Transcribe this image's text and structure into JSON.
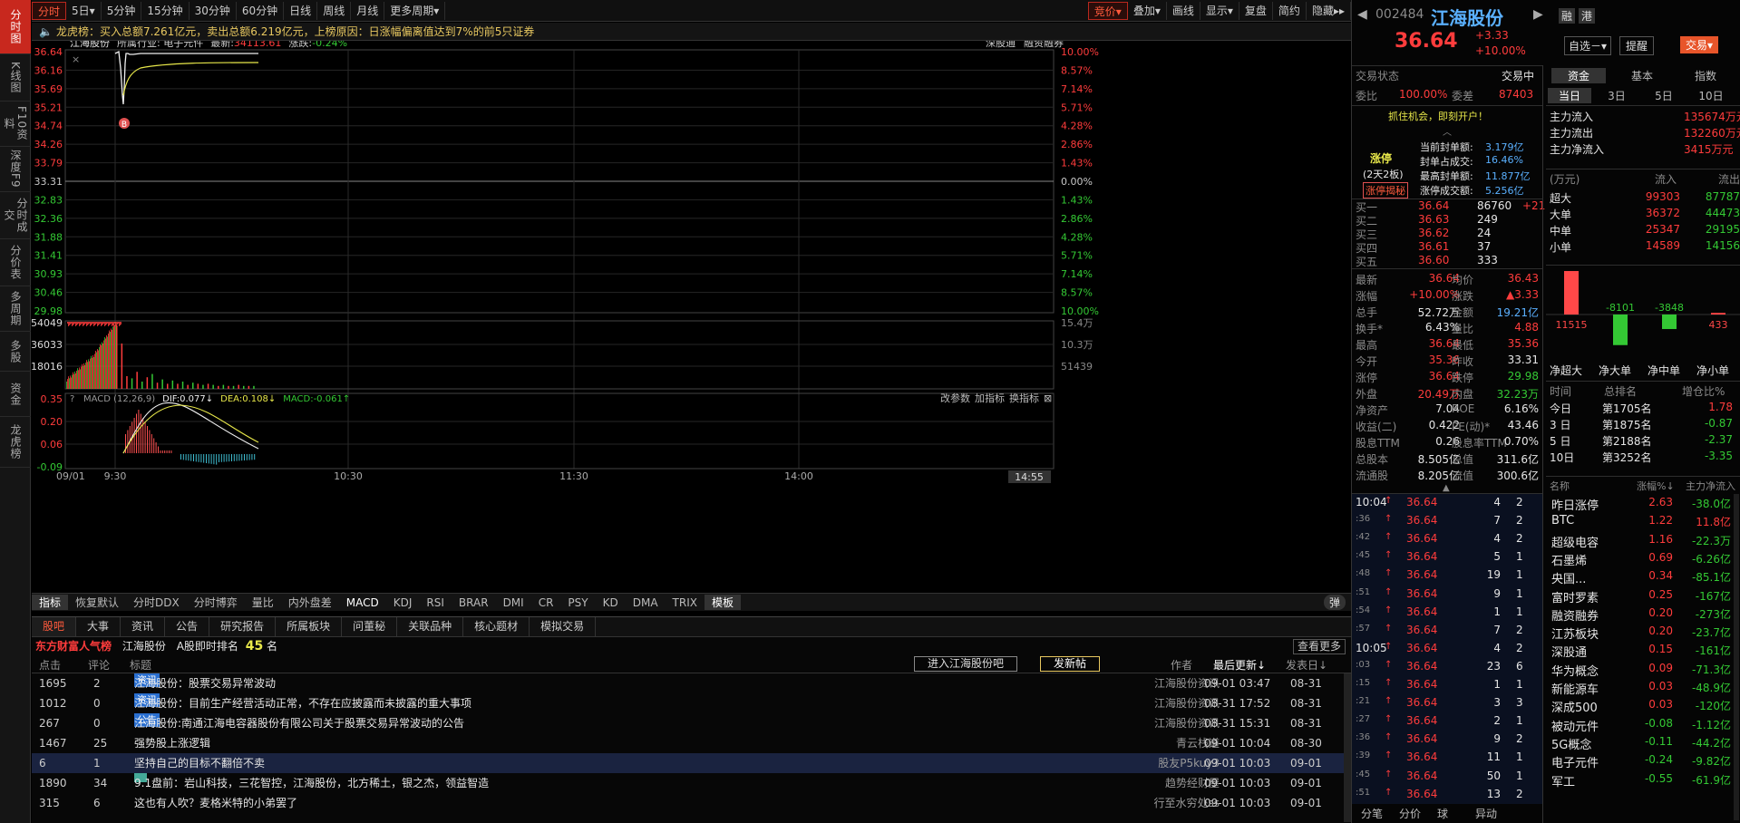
{
  "rail": [
    {
      "label": "分时图",
      "active": true
    },
    {
      "label": "K线图"
    },
    {
      "label": "F10资料"
    },
    {
      "label": "深度F9"
    },
    {
      "label": "分时成交"
    },
    {
      "label": "分价表"
    },
    {
      "label": "多周期"
    },
    {
      "label": "多股"
    },
    {
      "label": "资金"
    },
    {
      "label": "龙虎榜"
    }
  ],
  "toolbar": {
    "periods": [
      "分时",
      "5日▾",
      "5分钟",
      "15分钟",
      "30分钟",
      "60分钟",
      "日线",
      "周线",
      "月线",
      "更多周期▾"
    ],
    "right": [
      "竞价▾",
      "叠加▾",
      "画线",
      "显示▾",
      "复盘",
      "简约",
      "隐藏▸▸"
    ]
  },
  "notice": "龙虎榜：买入总额7.261亿元，卖出总额6.219亿元，上榜原因：日涨幅偏离值达到7%的前5只证券",
  "chart": {
    "stock_name": "江海股份",
    "industry": "所属行业: 电子元件",
    "latest_label": "最新:",
    "latest": "34113.61",
    "change_label": "涨跌:",
    "change": "-0.24%",
    "links": [
      "深股通",
      "融资融券"
    ],
    "price_ticks": [
      "36.64",
      "36.16",
      "35.69",
      "35.21",
      "34.74",
      "34.26",
      "33.79",
      "33.31",
      "32.83",
      "32.36",
      "31.88",
      "31.41",
      "30.93",
      "30.46",
      "29.98"
    ],
    "pct_ticks": [
      "10.00%",
      "8.57%",
      "7.14%",
      "5.71%",
      "4.28%",
      "2.86%",
      "1.43%",
      "0.00%",
      "1.43%",
      "2.86%",
      "4.28%",
      "5.71%",
      "7.14%",
      "8.57%",
      "10.00%"
    ],
    "vol_ticks": [
      "54049",
      "36033",
      "18016"
    ],
    "vol_right": [
      "15.4万",
      "10.3万",
      "51439"
    ],
    "macd_title": "MACD (12,26,9)",
    "dif": "DIF:0.077↓",
    "dea": "DEA:0.108↓",
    "macd": "MACD:-0.061↑",
    "macd_links": [
      "改参数",
      "加指标",
      "换指标"
    ],
    "macd_ticks": [
      "0.35",
      "0.20",
      "0.06",
      "-0.09"
    ],
    "time_ticks": [
      "09/01",
      "9:30",
      "10:30",
      "11:30",
      "14:00"
    ],
    "time_cursor": "14:55",
    "b_marker": "B"
  },
  "indicators": [
    "指标",
    "恢复默认",
    "分时DDX",
    "分时博弈",
    "量比",
    "内外盘差",
    "MACD",
    "KDJ",
    "RSI",
    "BRAR",
    "DMI",
    "CR",
    "PSY",
    "KD",
    "DMA",
    "TRIX",
    "模板"
  ],
  "indicator_toggle": "弹",
  "bottom": {
    "tabs": [
      "股吧",
      "大事",
      "资讯",
      "公告",
      "研究报告",
      "所属板块",
      "问董秘",
      "关联品种",
      "核心题材",
      "模拟交易"
    ],
    "rank_title": "东方财富人气榜",
    "rank_name": "江海股份",
    "rank_label": "A股即时排名",
    "rank": "45",
    "rank_unit": "名",
    "more": "查看更多",
    "cols": [
      "点击",
      "评论",
      "标题"
    ],
    "btn_enter": "进入江海股份吧",
    "btn_post": "发新帖",
    "cols_right": [
      "作者",
      "最后更新↓",
      "发表日↓"
    ],
    "rows": [
      {
        "clicks": "1695",
        "comments": "2",
        "tag": "资讯",
        "title": "江海股份：股票交易异常波动",
        "author": "江海股份资讯",
        "updated": "09-01 03:47",
        "date": "08-31"
      },
      {
        "clicks": "1012",
        "comments": "0",
        "tag": "资讯",
        "title": "江海股份：目前生产经营活动正常，不存在应披露而未披露的重大事项",
        "author": "江海股份资讯",
        "updated": "08-31 17:52",
        "date": "08-31"
      },
      {
        "clicks": "267",
        "comments": "0",
        "tag": "公告",
        "title": "江海股份:南通江海电容器股份有限公司关于股票交易异常波动的公告",
        "author": "江海股份资讯",
        "updated": "08-31 15:31",
        "date": "08-31"
      },
      {
        "clicks": "1467",
        "comments": "25",
        "tag": "",
        "title": "强势股上涨逻辑",
        "author": "青云栈道",
        "updated": "09-01 10:04",
        "date": "08-30"
      },
      {
        "clicks": "6",
        "comments": "1",
        "tag": "",
        "title": "坚持自己的目标不翻倍不卖",
        "author": "股友P5kuy3",
        "updated": "09-01 10:03",
        "date": "09-01",
        "selected": true
      },
      {
        "clicks": "1890",
        "comments": "34",
        "tag": "img",
        "title": "9.1盘前：岩山科技，三花智控，江海股份，北方稀土，银之杰，领益智造",
        "author": "趋势经财屋",
        "updated": "09-01 10:03",
        "date": "09-01"
      },
      {
        "clicks": "315",
        "comments": "6",
        "tag": "",
        "title": "这也有人吹？麦格米特的小弟罢了",
        "author": "行至水穷处ss",
        "updated": "09-01 10:03",
        "date": "09-01"
      }
    ]
  },
  "quote": {
    "code": "002484",
    "name": "江海股份",
    "price": "36.64",
    "change": "+3.33",
    "pct": "+10.00%",
    "btns": [
      "融",
      "港"
    ],
    "zixuan": "自选－▾",
    "remind": "提醒",
    "trade": "交易▾",
    "status_label": "交易状态",
    "status": "交易中",
    "weibi_label": "委比",
    "weibi": "100.00%",
    "weicha_label": "委差",
    "weicha": "87403",
    "ad": "抓住机会，即刻开户！",
    "limit_title": "涨停",
    "limit_sub": "(2天2板)",
    "limit_btn": "涨停揭秘",
    "limit_info": [
      [
        "当前封单额:",
        "3.179亿"
      ],
      [
        "封单占成交:",
        "16.46%"
      ],
      [
        "最高封单额:",
        "11.877亿"
      ],
      [
        "涨停成交额:",
        "5.256亿"
      ]
    ],
    "bids": [
      [
        "买一",
        "36.64",
        "86760",
        "+21"
      ],
      [
        "买二",
        "36.63",
        "249",
        ""
      ],
      [
        "买三",
        "36.62",
        "24",
        ""
      ],
      [
        "买四",
        "36.61",
        "37",
        ""
      ],
      [
        "买五",
        "36.60",
        "333",
        ""
      ]
    ],
    "stats": [
      [
        "最新",
        "36.64",
        "均价",
        "36.43"
      ],
      [
        "涨幅",
        "+10.00%",
        "涨跌",
        "▲3.33"
      ],
      [
        "总手",
        "52.72万",
        "金额",
        "19.21亿"
      ],
      [
        "换手*",
        "6.43%",
        "量比",
        "4.88"
      ],
      [
        "最高",
        "36.64",
        "最低",
        "35.36"
      ],
      [
        "今开",
        "35.36",
        "昨收",
        "33.31"
      ],
      [
        "涨停",
        "36.64",
        "跌停",
        "29.98"
      ],
      [
        "外盘",
        "20.49万",
        "内盘",
        "32.23万"
      ],
      [
        "净资产",
        "7.04",
        "ROE",
        "6.16%"
      ],
      [
        "收益(二)",
        "0.422",
        "PE(动)*",
        "43.46"
      ],
      [
        "股息TTM",
        "0.26",
        "股息率TTM",
        "0.70%"
      ],
      [
        "总股本",
        "8.505亿",
        "总值",
        "311.6亿"
      ],
      [
        "流通股",
        "8.205亿",
        "流值",
        "300.6亿"
      ]
    ],
    "ticks": [
      [
        "10:04",
        "36.64",
        "4",
        "2"
      ],
      [
        ":36",
        "36.64",
        "7",
        "2"
      ],
      [
        ":42",
        "36.64",
        "4",
        "2"
      ],
      [
        ":45",
        "36.64",
        "5",
        "1"
      ],
      [
        ":48",
        "36.64",
        "19",
        "1"
      ],
      [
        ":51",
        "36.64",
        "9",
        "1"
      ],
      [
        ":54",
        "36.64",
        "1",
        "1"
      ],
      [
        ":57",
        "36.64",
        "7",
        "2"
      ],
      [
        "10:05",
        "36.64",
        "4",
        "2"
      ],
      [
        ":03",
        "36.64",
        "23",
        "6"
      ],
      [
        ":15",
        "36.64",
        "1",
        "1"
      ],
      [
        ":21",
        "36.64",
        "3",
        "3"
      ],
      [
        ":27",
        "36.64",
        "2",
        "1"
      ],
      [
        ":36",
        "36.64",
        "9",
        "2"
      ],
      [
        ":39",
        "36.64",
        "11",
        "1"
      ],
      [
        ":45",
        "36.64",
        "50",
        "1"
      ],
      [
        ":51",
        "36.64",
        "13",
        "2"
      ]
    ],
    "tick_tabs": [
      "分笔",
      "分价",
      "球",
      "异动"
    ]
  },
  "fund": {
    "tabs": [
      "资金",
      "基本",
      "指数"
    ],
    "days": [
      "当日",
      "3日",
      "5日",
      "10日"
    ],
    "flows": [
      [
        "主力流入",
        "135674万元"
      ],
      [
        "主力流出",
        "132260万元"
      ],
      [
        "主力净流入",
        "3415万元"
      ]
    ],
    "head": [
      "(万元)",
      "流入",
      "流出"
    ],
    "sizes": [
      [
        "超大",
        "99303",
        "87787"
      ],
      [
        "大单",
        "36372",
        "44473"
      ],
      [
        "中单",
        "25347",
        "29195"
      ],
      [
        "小单",
        "14589",
        "14156"
      ]
    ],
    "net": {
      "labels": [
        "净超大",
        "净大单",
        "净中单",
        "净小单"
      ],
      "values": [
        11515,
        -8101,
        -3848,
        433
      ],
      "texts": [
        "11515",
        "-8101",
        "-3848",
        "433"
      ]
    },
    "rank_head": [
      "时间",
      "总排名",
      "增仓比%"
    ],
    "ranks": [
      [
        "今日",
        "第1705名",
        "1.78"
      ],
      [
        "3 日",
        "第1875名",
        "-0.87"
      ],
      [
        "5 日",
        "第2188名",
        "-2.37"
      ],
      [
        "10日",
        "第3252名",
        "-3.35"
      ]
    ],
    "sec_head": [
      "名称",
      "涨幅%↓",
      "主力净流入"
    ],
    "sectors": [
      [
        "昨日涨停",
        "2.63",
        "-38.0亿"
      ],
      [
        "BTC",
        "1.22",
        "11.8亿"
      ],
      [
        "超级电容",
        "1.16",
        "-22.3万"
      ],
      [
        "石墨烯",
        "0.69",
        "-6.26亿"
      ],
      [
        "央国...",
        "0.34",
        "-85.1亿"
      ],
      [
        "富时罗素",
        "0.25",
        "-167亿"
      ],
      [
        "融资融券",
        "0.20",
        "-273亿"
      ],
      [
        "江苏板块",
        "0.20",
        "-23.7亿"
      ],
      [
        "深股通",
        "0.15",
        "-161亿"
      ],
      [
        "华为概念",
        "0.09",
        "-71.3亿"
      ],
      [
        "新能源车",
        "0.03",
        "-48.9亿"
      ],
      [
        "深成500",
        "0.03",
        "-120亿"
      ],
      [
        "被动元件",
        "-0.08",
        "-1.12亿"
      ],
      [
        "5G概念",
        "-0.11",
        "-44.2亿"
      ],
      [
        "电子元件",
        "-0.24",
        "-9.82亿"
      ],
      [
        "军工",
        "-0.55",
        "-61.9亿"
      ]
    ]
  }
}
